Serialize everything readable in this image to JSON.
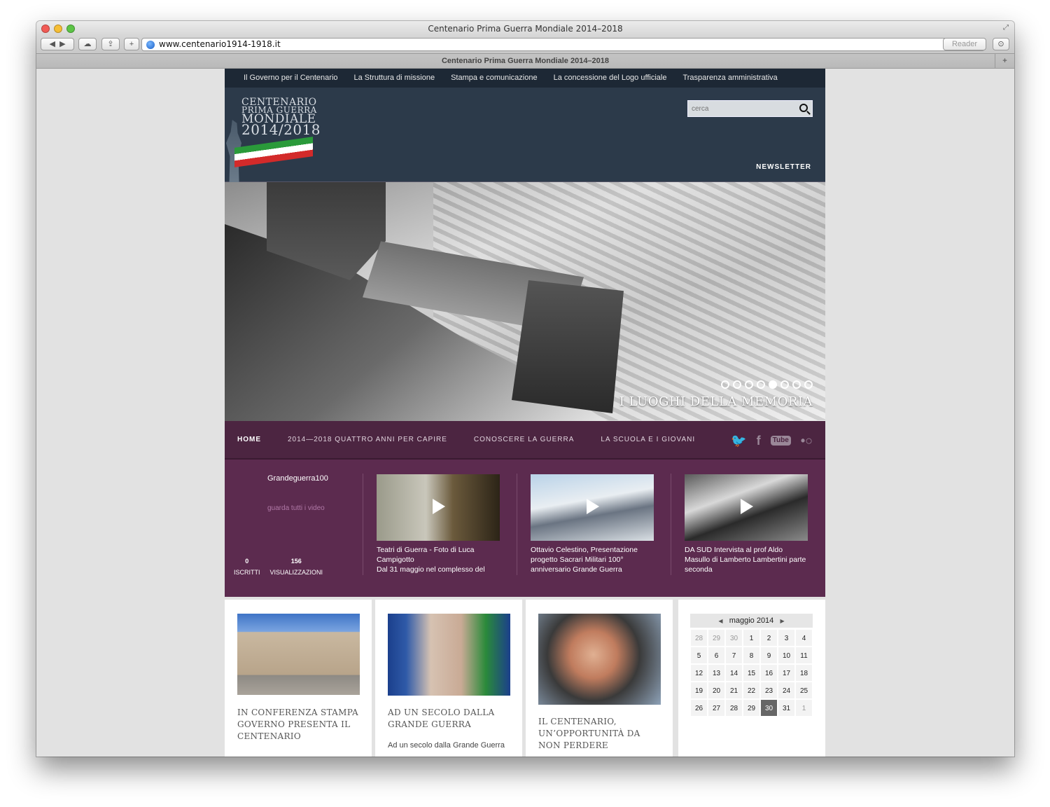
{
  "browser": {
    "window_title": "Centenario Prima Guerra Mondiale 2014–2018",
    "url": "www.centenario1914-1918.it",
    "reader_label": "Reader",
    "tab_title": "Centenario Prima Guerra Mondiale 2014–2018",
    "tab_add": "+"
  },
  "topnav": [
    "Il Governo per il Centenario",
    "La Struttura di missione",
    "Stampa e comunicazione",
    "La concessione del Logo ufficiale",
    "Trasparenza amministrativa"
  ],
  "logo": {
    "line1": "CENTENARIO",
    "line2": "PRIMA GUERRA",
    "line3": "MONDIALE",
    "line4": "2014/2018"
  },
  "search": {
    "placeholder": "cerca"
  },
  "newsletter": "NEWSLETTER",
  "hero": {
    "caption": "I LUOGHI DELLA MEMORIA",
    "slides": 8,
    "active_slide": 5
  },
  "mainnav": {
    "items": [
      "HOME",
      "2014—2018 QUATTRO ANNI PER CAPIRE",
      "CONOSCERE LA GUERRA",
      "LA SCUOLA E I GIOVANI"
    ],
    "social": [
      "twitter-icon",
      "facebook-icon",
      "youtube-icon",
      "flickr-icon"
    ],
    "youtube_label": "Tube"
  },
  "videos": {
    "channel": "Grandeguerra100",
    "view_all": "guarda tutti i video",
    "subscribers": "0",
    "subscribers_label": "ISCRITTI",
    "views": "156",
    "views_label": "VISUALIZZAZIONI",
    "items": [
      "Teatri di Guerra - Foto di Luca Campigotto\nDal 31 maggio nel complesso del",
      "Ottavio Celestino, Presentazione progetto Sacrari Militari 100° anniversario Grande Guerra",
      "DA SUD Intervista al prof Aldo Masullo di Lamberto Lambertini parte seconda"
    ]
  },
  "cards": [
    {
      "title": "IN CONFERENZA STAMPA GOVERNO PRESENTA IL CENTENARIO",
      "sub": ""
    },
    {
      "title": "AD UN SECOLO DALLA GRANDE GUERRA",
      "sub": "Ad un secolo dalla Grande Guerra"
    },
    {
      "title": "IL CENTENARIO, UN’OPPORTUNITÀ DA NON PERDERE",
      "sub": ""
    }
  ],
  "calendar": {
    "month": "maggio 2014",
    "prev": "◀",
    "next": "▶",
    "days": [
      "28",
      "29",
      "30",
      "1",
      "2",
      "3",
      "4",
      "5",
      "6",
      "7",
      "8",
      "9",
      "10",
      "11",
      "12",
      "13",
      "14",
      "15",
      "16",
      "17",
      "18",
      "19",
      "20",
      "21",
      "22",
      "23",
      "24",
      "25",
      "26",
      "27",
      "28",
      "29",
      "30",
      "31",
      "1"
    ],
    "today": "30"
  }
}
